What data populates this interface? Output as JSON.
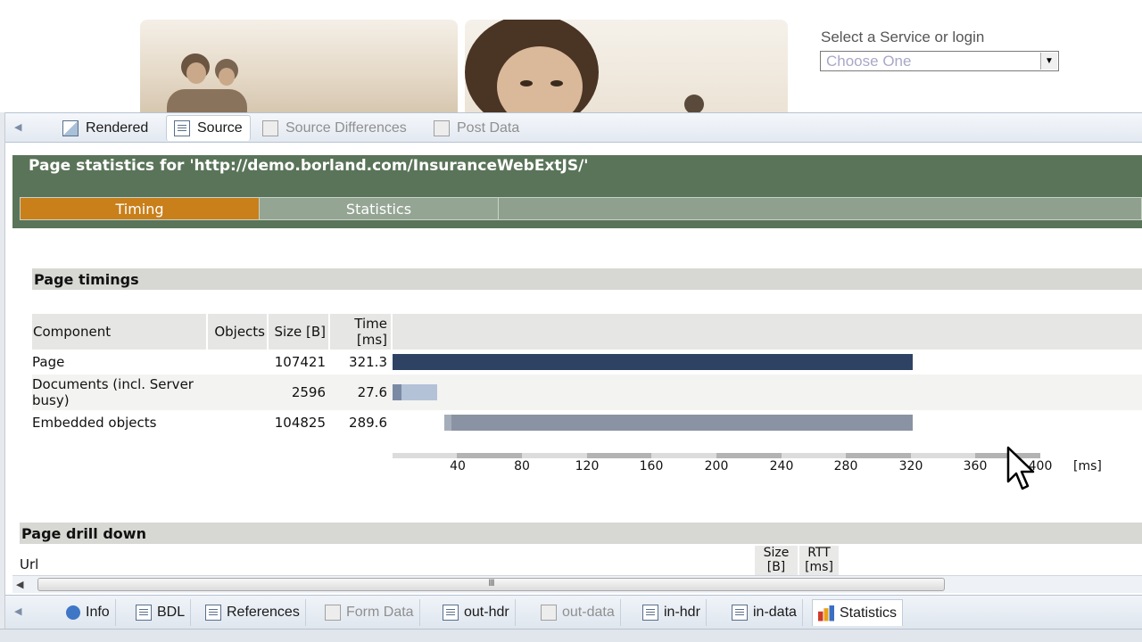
{
  "web_page": {
    "service_label": "Select a Service or login",
    "service_select_value": "Choose One"
  },
  "view_tabs": [
    {
      "label": "Rendered",
      "icon": "rendered-icon",
      "state": "normal"
    },
    {
      "label": "Source",
      "icon": "source-icon",
      "state": "active"
    },
    {
      "label": "Source Differences",
      "icon": "source-differences-icon",
      "state": "disabled"
    },
    {
      "label": "Post Data",
      "icon": "post-data-icon",
      "state": "disabled"
    }
  ],
  "stats": {
    "title": "Page statistics for 'http://demo.borland.com/InsuranceWebExtJS/'",
    "tabs": [
      "Timing",
      "Statistics"
    ],
    "active_tab": "Timing"
  },
  "timings": {
    "heading": "Page timings",
    "columns": [
      "Component",
      "Objects",
      "Size [B]",
      "Time\n[ms]"
    ],
    "rows": [
      {
        "component": "Page",
        "objects": "",
        "size": "107421",
        "time": "321.3",
        "bar_start_ms": 0,
        "bar_end_ms": 321.3,
        "color": "#2e4364"
      },
      {
        "component": "Documents (incl. Server busy)",
        "objects": "",
        "size": "2596",
        "time": "27.6",
        "bar_start_ms": 0,
        "bar_end_ms": 27.6,
        "color": "#b4c2d8"
      },
      {
        "component": "Embedded objects",
        "objects": "",
        "size": "104825",
        "time": "289.6",
        "bar_start_ms": 32,
        "bar_end_ms": 321.3,
        "color": "#8a93a3"
      }
    ],
    "axis": {
      "ticks": [
        "40",
        "80",
        "120",
        "160",
        "200",
        "240",
        "280",
        "320",
        "360",
        "400"
      ],
      "unit": "[ms]",
      "max_ms": 400
    }
  },
  "drill_down": {
    "heading": "Page drill down",
    "url_label": "Url",
    "columns": [
      "Size\n[B]",
      "RTT\n[ms]"
    ]
  },
  "scrollbar": {
    "grip": "III"
  },
  "bottom_tabs": [
    {
      "label": "Info",
      "icon": "info-icon",
      "state": "normal"
    },
    {
      "label": "BDL",
      "icon": "bdl-icon",
      "state": "normal"
    },
    {
      "label": "References",
      "icon": "references-icon",
      "state": "normal"
    },
    {
      "label": "Form Data",
      "icon": "form-data-icon",
      "state": "disabled"
    },
    {
      "label": "out-hdr",
      "icon": "out-hdr-icon",
      "state": "normal"
    },
    {
      "label": "out-data",
      "icon": "out-data-icon",
      "state": "disabled"
    },
    {
      "label": "in-hdr",
      "icon": "in-hdr-icon",
      "state": "normal"
    },
    {
      "label": "in-data",
      "icon": "in-data-icon",
      "state": "normal"
    },
    {
      "label": "Statistics",
      "icon": "statistics-chart-icon",
      "state": "active"
    }
  ]
}
